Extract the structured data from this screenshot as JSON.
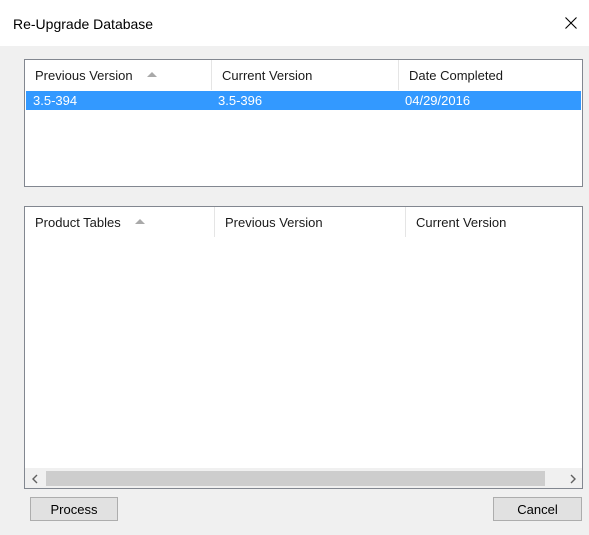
{
  "window": {
    "title": "Re-Upgrade Database",
    "close_icon": "close-icon"
  },
  "upgrade_list": {
    "columns": [
      "Previous Version",
      "Current Version",
      "Date Completed"
    ],
    "sorted_column": "Previous Version",
    "sort_direction": "ascending",
    "rows": [
      {
        "previous": "3.5-394",
        "current": "3.5-396",
        "date": "04/29/2016",
        "selected": true
      }
    ],
    "selection_color": "#3399ff"
  },
  "product_tables": {
    "columns": [
      "Product Tables",
      "Previous Version",
      "Current Version"
    ],
    "sorted_column": "Product Tables",
    "sort_direction": "ascending",
    "rows": []
  },
  "buttons": {
    "process": "Process",
    "cancel": "Cancel"
  }
}
